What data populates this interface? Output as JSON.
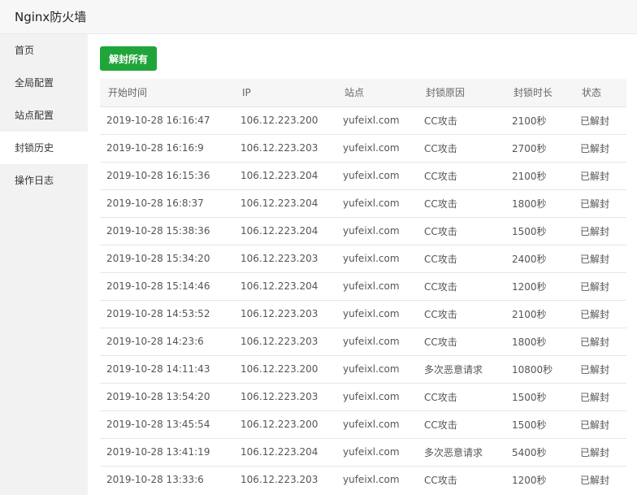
{
  "app": {
    "title": "Nginx防火墙"
  },
  "sidebar": {
    "items": [
      {
        "label": "首页"
      },
      {
        "label": "全局配置"
      },
      {
        "label": "站点配置"
      },
      {
        "label": "封锁历史"
      },
      {
        "label": "操作日志"
      }
    ],
    "active_index": 3
  },
  "toolbar": {
    "unblock_all_label": "解封所有"
  },
  "table": {
    "columns": [
      "开始时间",
      "IP",
      "站点",
      "封锁原因",
      "封锁时长",
      "状态"
    ],
    "rows": [
      [
        "2019-10-28 16:16:47",
        "106.12.223.200",
        "yufeixl.com",
        "CC攻击",
        "2100秒",
        "已解封"
      ],
      [
        "2019-10-28 16:16:9",
        "106.12.223.203",
        "yufeixl.com",
        "CC攻击",
        "2700秒",
        "已解封"
      ],
      [
        "2019-10-28 16:15:36",
        "106.12.223.204",
        "yufeixl.com",
        "CC攻击",
        "2100秒",
        "已解封"
      ],
      [
        "2019-10-28 16:8:37",
        "106.12.223.204",
        "yufeixl.com",
        "CC攻击",
        "1800秒",
        "已解封"
      ],
      [
        "2019-10-28 15:38:36",
        "106.12.223.204",
        "yufeixl.com",
        "CC攻击",
        "1500秒",
        "已解封"
      ],
      [
        "2019-10-28 15:34:20",
        "106.12.223.203",
        "yufeixl.com",
        "CC攻击",
        "2400秒",
        "已解封"
      ],
      [
        "2019-10-28 15:14:46",
        "106.12.223.204",
        "yufeixl.com",
        "CC攻击",
        "1200秒",
        "已解封"
      ],
      [
        "2019-10-28 14:53:52",
        "106.12.223.203",
        "yufeixl.com",
        "CC攻击",
        "2100秒",
        "已解封"
      ],
      [
        "2019-10-28 14:23:6",
        "106.12.223.203",
        "yufeixl.com",
        "CC攻击",
        "1800秒",
        "已解封"
      ],
      [
        "2019-10-28 14:11:43",
        "106.12.223.200",
        "yufeixl.com",
        "多次恶意请求",
        "10800秒",
        "已解封"
      ],
      [
        "2019-10-28 13:54:20",
        "106.12.223.203",
        "yufeixl.com",
        "CC攻击",
        "1500秒",
        "已解封"
      ],
      [
        "2019-10-28 13:45:54",
        "106.12.223.200",
        "yufeixl.com",
        "CC攻击",
        "1500秒",
        "已解封"
      ],
      [
        "2019-10-28 13:41:19",
        "106.12.223.204",
        "yufeixl.com",
        "多次恶意请求",
        "5400秒",
        "已解封"
      ],
      [
        "2019-10-28 13:33:6",
        "106.12.223.203",
        "yufeixl.com",
        "CC攻击",
        "1200秒",
        "已解封"
      ]
    ]
  },
  "colors": {
    "primary_button": "#20a53a",
    "sidebar_bg": "#f2f2f2",
    "header_bg": "#f6f6f6"
  }
}
